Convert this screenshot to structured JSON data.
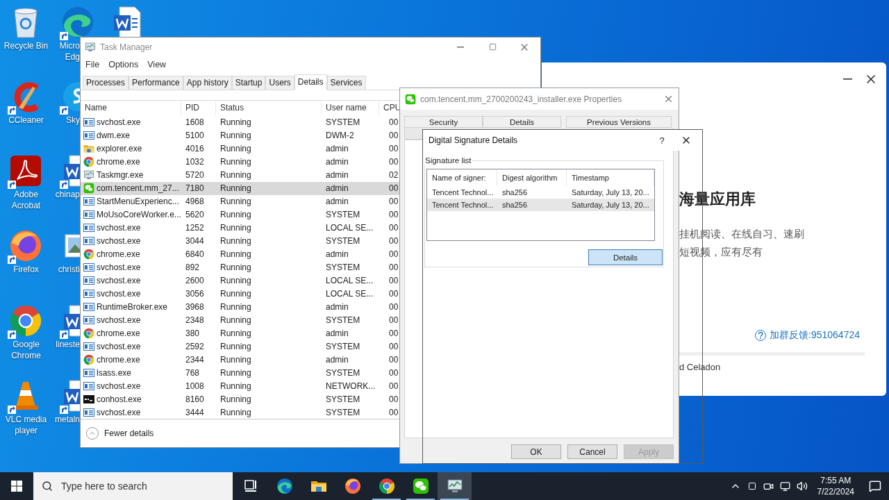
{
  "desktop": {
    "columns": [
      [
        {
          "kind": "recycle",
          "label": "Recycle Bin",
          "shortcut": false
        },
        {
          "kind": "ccleaner",
          "label": "CCleaner",
          "shortcut": true
        },
        {
          "kind": "acrobat",
          "label": "Adobe\nAcrobat",
          "shortcut": true
        },
        {
          "kind": "firefox",
          "label": "Firefox",
          "shortcut": true
        },
        {
          "kind": "chrome",
          "label": "Google\nChrome",
          "shortcut": true
        },
        {
          "kind": "vlc",
          "label": "VLC media\nplayer",
          "shortcut": true
        }
      ],
      [
        {
          "kind": "edge",
          "label": "Micro\nEdg",
          "shortcut": true
        },
        {
          "kind": "skype",
          "label": "Sky",
          "shortcut": true
        },
        {
          "kind": "word",
          "label": "chinap",
          "shortcut": true
        },
        {
          "kind": "image",
          "label": "christi",
          "shortcut": false
        },
        {
          "kind": "word",
          "label": "lineste",
          "shortcut": true
        },
        {
          "kind": "word",
          "label": "metaln",
          "shortcut": true
        }
      ],
      [
        {
          "kind": "word"
        }
      ]
    ]
  },
  "installer": {
    "heading": "海量应用库",
    "lines": [
      "挂机阅读、在线自习、速刷",
      "短视频，应有尽有"
    ],
    "feedback_link": "加群反馈:951064724",
    "footer_text": "d Celadon"
  },
  "task_manager": {
    "title": "Task Manager",
    "menu": [
      "File",
      "Options",
      "View"
    ],
    "tabs": [
      {
        "label": "Processes",
        "selected": false
      },
      {
        "label": "Performance",
        "selected": false
      },
      {
        "label": "App history",
        "selected": false
      },
      {
        "label": "Startup",
        "selected": false
      },
      {
        "label": "Users",
        "selected": false
      },
      {
        "label": "Details",
        "selected": true
      },
      {
        "label": "Services",
        "selected": false
      }
    ],
    "columns": [
      "Name",
      "PID",
      "Status",
      "User name",
      "CPU"
    ],
    "rows": [
      {
        "kind": "service",
        "name": "svchost.exe",
        "pid": "1608",
        "status": "Running",
        "user": "SYSTEM",
        "cpu": "00",
        "selected": false
      },
      {
        "kind": "service",
        "name": "dwm.exe",
        "pid": "5100",
        "status": "Running",
        "user": "DWM-2",
        "cpu": "00",
        "selected": false
      },
      {
        "kind": "folder",
        "name": "explorer.exe",
        "pid": "4016",
        "status": "Running",
        "user": "admin",
        "cpu": "00",
        "selected": false
      },
      {
        "kind": "chrome",
        "name": "chrome.exe",
        "pid": "1032",
        "status": "Running",
        "user": "admin",
        "cpu": "00",
        "selected": false
      },
      {
        "kind": "monitor",
        "name": "Taskmgr.exe",
        "pid": "5720",
        "status": "Running",
        "user": "admin",
        "cpu": "02",
        "selected": false
      },
      {
        "kind": "chat",
        "name": "com.tencent.mm_27...",
        "pid": "7180",
        "status": "Running",
        "user": "admin",
        "cpu": "00",
        "selected": true
      },
      {
        "kind": "service",
        "name": "StartMenuExperienc...",
        "pid": "4968",
        "status": "Running",
        "user": "admin",
        "cpu": "00",
        "selected": false
      },
      {
        "kind": "service",
        "name": "MoUsoCoreWorker.e...",
        "pid": "5620",
        "status": "Running",
        "user": "SYSTEM",
        "cpu": "00",
        "selected": false
      },
      {
        "kind": "service",
        "name": "svchost.exe",
        "pid": "1252",
        "status": "Running",
        "user": "LOCAL SE...",
        "cpu": "00",
        "selected": false
      },
      {
        "kind": "service",
        "name": "svchost.exe",
        "pid": "3044",
        "status": "Running",
        "user": "SYSTEM",
        "cpu": "00",
        "selected": false
      },
      {
        "kind": "chrome",
        "name": "chrome.exe",
        "pid": "6840",
        "status": "Running",
        "user": "admin",
        "cpu": "00",
        "selected": false
      },
      {
        "kind": "service",
        "name": "svchost.exe",
        "pid": "892",
        "status": "Running",
        "user": "SYSTEM",
        "cpu": "00",
        "selected": false
      },
      {
        "kind": "service",
        "name": "svchost.exe",
        "pid": "2600",
        "status": "Running",
        "user": "LOCAL SE...",
        "cpu": "00",
        "selected": false
      },
      {
        "kind": "service",
        "name": "svchost.exe",
        "pid": "3056",
        "status": "Running",
        "user": "LOCAL SE...",
        "cpu": "00",
        "selected": false
      },
      {
        "kind": "service",
        "name": "RuntimeBroker.exe",
        "pid": "3968",
        "status": "Running",
        "user": "admin",
        "cpu": "00",
        "selected": false
      },
      {
        "kind": "service",
        "name": "svchost.exe",
        "pid": "2348",
        "status": "Running",
        "user": "SYSTEM",
        "cpu": "00",
        "selected": false
      },
      {
        "kind": "chrome",
        "name": "chrome.exe",
        "pid": "380",
        "status": "Running",
        "user": "admin",
        "cpu": "00",
        "selected": false
      },
      {
        "kind": "service",
        "name": "svchost.exe",
        "pid": "2592",
        "status": "Running",
        "user": "SYSTEM",
        "cpu": "00",
        "selected": false
      },
      {
        "kind": "chrome",
        "name": "chrome.exe",
        "pid": "2344",
        "status": "Running",
        "user": "admin",
        "cpu": "00",
        "selected": false
      },
      {
        "kind": "service",
        "name": "lsass.exe",
        "pid": "768",
        "status": "Running",
        "user": "SYSTEM",
        "cpu": "00",
        "selected": false
      },
      {
        "kind": "service",
        "name": "svchost.exe",
        "pid": "1008",
        "status": "Running",
        "user": "NETWORK...",
        "cpu": "00",
        "selected": false
      },
      {
        "kind": "console",
        "name": "conhost.exe",
        "pid": "8160",
        "status": "Running",
        "user": "SYSTEM",
        "cpu": "00",
        "selected": false
      },
      {
        "kind": "service",
        "name": "svchost.exe",
        "pid": "3444",
        "status": "Running",
        "user": "SYSTEM",
        "cpu": "00",
        "selected": false
      }
    ],
    "footer": "Fewer details"
  },
  "properties": {
    "title": "com.tencent.mm_2700200243_installer.exe Properties",
    "tabs": [
      {
        "label": "Security",
        "selected": false
      },
      {
        "label": "Details",
        "selected": false
      },
      {
        "label": "Previous Versions",
        "selected": false
      }
    ],
    "buttons": [
      {
        "label": "OK",
        "disabled": false
      },
      {
        "label": "Cancel",
        "disabled": false
      },
      {
        "label": "Apply",
        "disabled": true
      }
    ]
  },
  "signature_dialog": {
    "title": "Digital Signature Details",
    "help": "?",
    "group_label": "Signature list",
    "columns": [
      "Name of signer:",
      "Digest algorithm",
      "Timestamp"
    ],
    "rows": [
      {
        "signer": "Tencent Technol...",
        "digest": "sha256",
        "timestamp": "Saturday, July 13, 20...",
        "selected": false
      },
      {
        "signer": "Tencent Technol...",
        "digest": "sha256",
        "timestamp": "Saturday, July 13, 20...",
        "selected": true
      }
    ],
    "details_button": {
      "label": "Details",
      "focused": true
    }
  },
  "taskbar": {
    "search_placeholder": "Type here to search",
    "apps": [
      {
        "kind": "task-view",
        "running": false,
        "active": false
      },
      {
        "kind": "edge",
        "running": false,
        "active": false
      },
      {
        "kind": "explorer",
        "running": false,
        "active": false
      },
      {
        "kind": "firefox",
        "running": false,
        "active": false
      },
      {
        "kind": "chrome",
        "running": true,
        "active": false
      },
      {
        "kind": "wechat",
        "running": true,
        "active": false
      },
      {
        "kind": "taskmgr",
        "running": true,
        "active": true
      }
    ],
    "time": "7:55 AM",
    "date": "7/22/2024"
  }
}
